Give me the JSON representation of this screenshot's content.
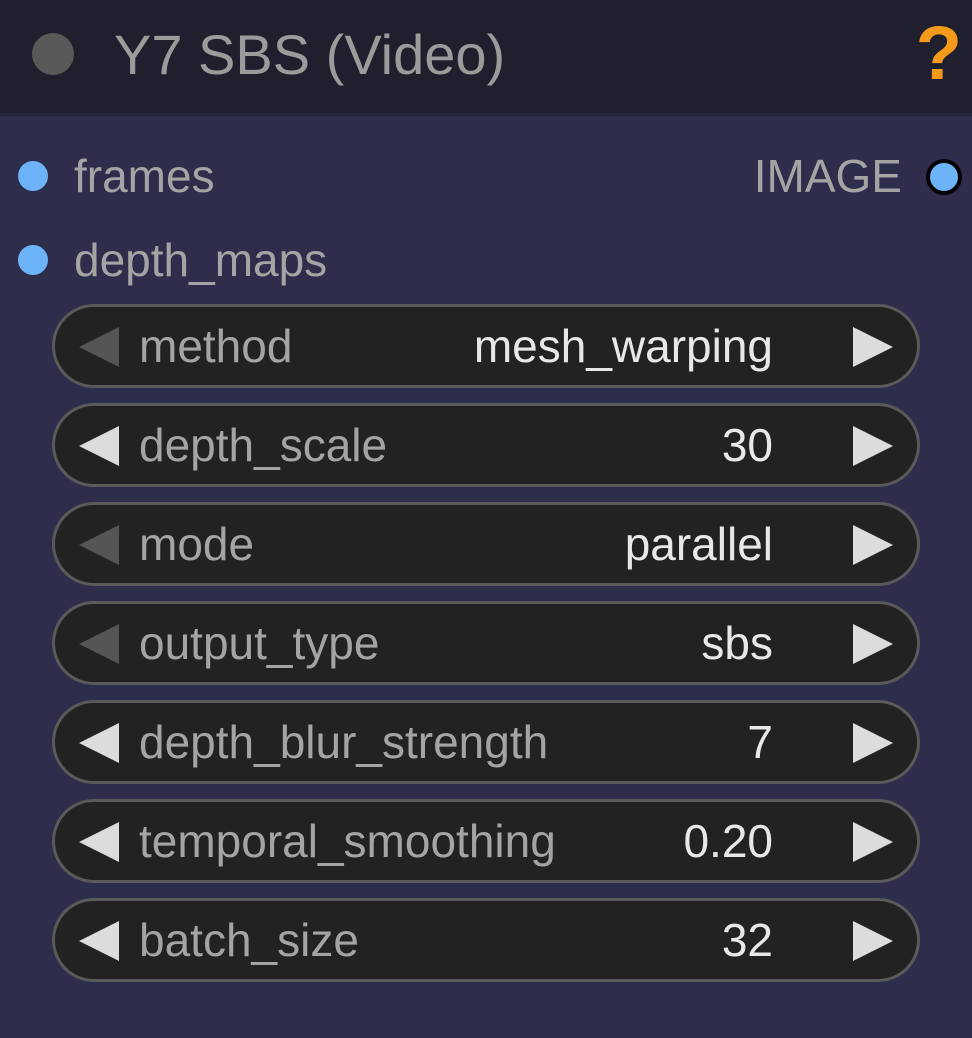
{
  "node": {
    "title": "Y7 SBS (Video)",
    "help_label": "?"
  },
  "inputs": [
    {
      "name": "frames"
    },
    {
      "name": "depth_maps"
    }
  ],
  "outputs": [
    {
      "name": "IMAGE"
    }
  ],
  "widgets": [
    {
      "label": "method",
      "value": "mesh_warping"
    },
    {
      "label": "depth_scale",
      "value": "30"
    },
    {
      "label": "mode",
      "value": "parallel"
    },
    {
      "label": "output_type",
      "value": "sbs"
    },
    {
      "label": "depth_blur_strength",
      "value": "7"
    },
    {
      "label": "temporal_smoothing",
      "value": "0.20"
    },
    {
      "label": "batch_size",
      "value": "32"
    }
  ],
  "colors": {
    "slot_image": "#6db3f8",
    "help": "#f39a1a",
    "node_body": "#2e2d4b",
    "title_bar": "#1f1f2d"
  }
}
